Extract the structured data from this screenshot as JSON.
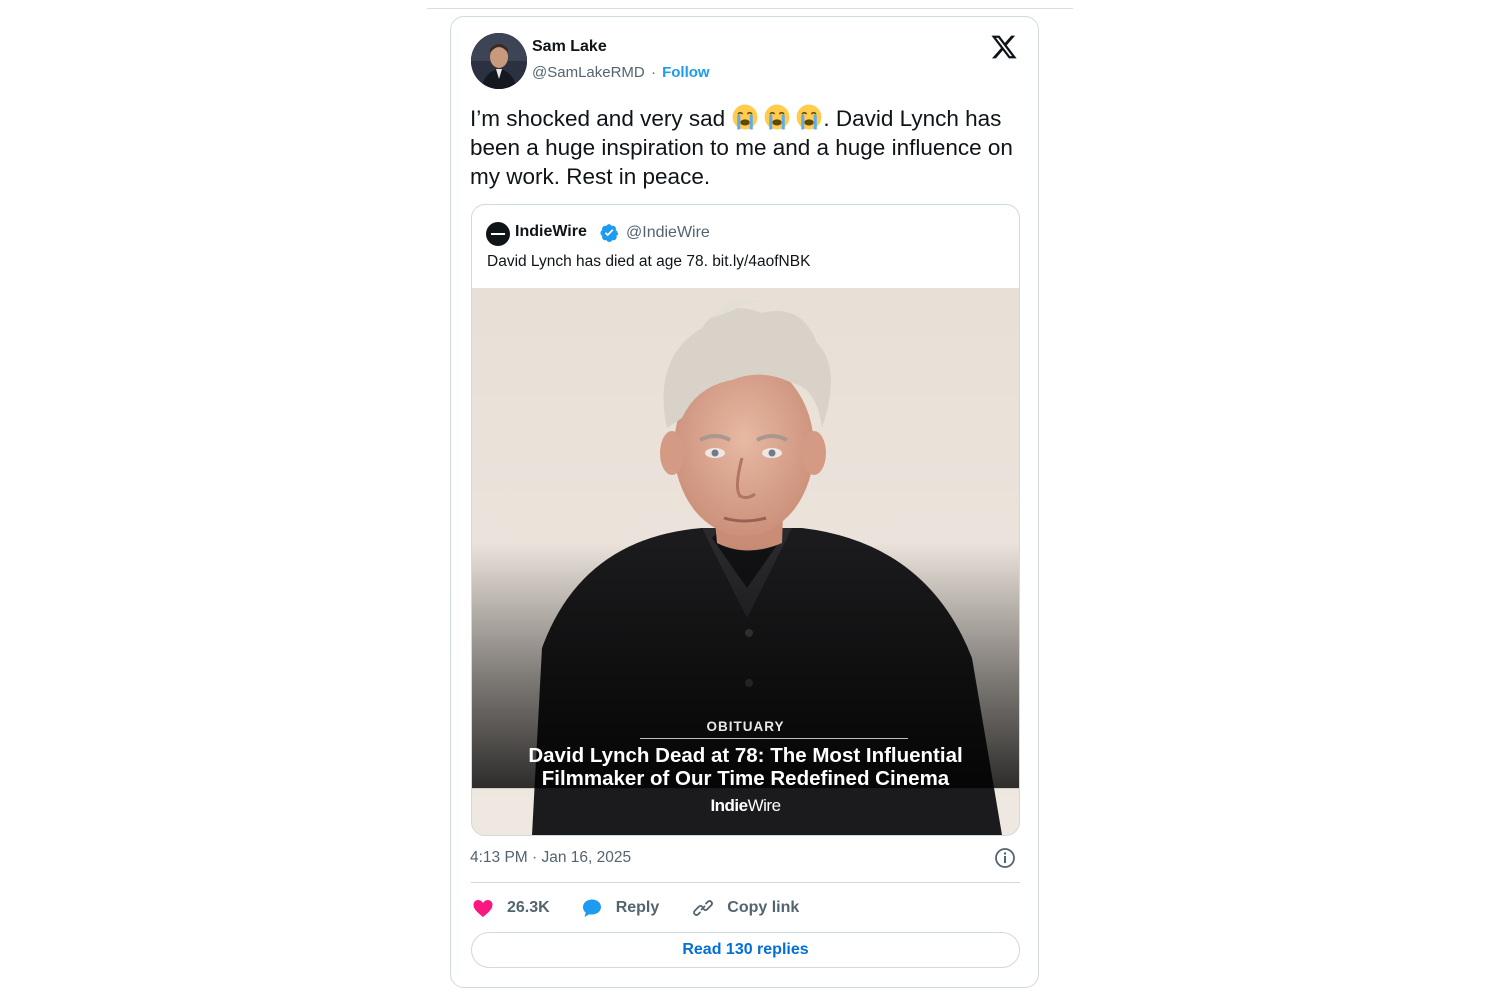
{
  "author": {
    "name": "Sam Lake",
    "handle": "@SamLakeRMD",
    "separator": "·",
    "follow_label": "Follow"
  },
  "tweet": {
    "text_before_emoji": "I’m shocked and very sad ",
    "emoji": [
      "loudly-crying-face",
      "loudly-crying-face",
      "loudly-crying-face"
    ],
    "text_after_emoji": ". David Lynch has been a huge inspiration to me and a huge influence on my work. Rest in peace.",
    "timestamp": "4:13 PM · Jan 16, 2025"
  },
  "quote": {
    "name": "IndieWire",
    "handle": "@IndieWire",
    "text": "David Lynch has died at age 78. bit.ly/4aofNBK",
    "image": {
      "label": "OBITUARY",
      "headline_line1": "David Lynch Dead at 78: The Most Influential",
      "headline_line2": "Filmmaker of Our Time Redefined Cinema",
      "brand_bold": "Indie",
      "brand_light": "Wire"
    }
  },
  "actions": {
    "likes": "26.3K",
    "reply_label": "Reply",
    "copy_link_label": "Copy link",
    "read_replies_label": "Read 130 replies"
  },
  "colors": {
    "accent": "#1d9bf0",
    "like": "#f91880",
    "link": "#006fd6",
    "muted": "#536471",
    "border": "#cfd9de"
  }
}
